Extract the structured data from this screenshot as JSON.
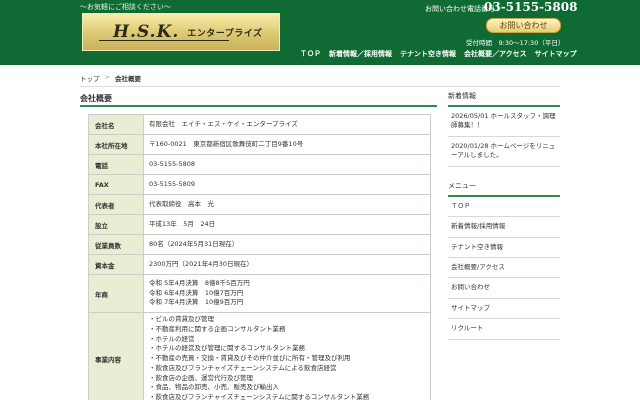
{
  "header": {
    "tagline": "～お気軽にご相談ください～",
    "logo_mark": "H.S.K.",
    "logo_sub": "エンタープライズ",
    "phone_label": "お問い合わせ電話番号",
    "phone": "03-5155-5808",
    "contact_button": "お問い合わせ",
    "hours": "受付時間　9:30～17:30（平日）",
    "nav": [
      "ＴＯＰ",
      "新着情報／採用情報",
      "テナント空き情報",
      "会社概要／アクセス",
      "サイトマップ"
    ]
  },
  "breadcrumb": {
    "home": "トップ",
    "sep": ">",
    "current": "会社概要"
  },
  "main": {
    "title": "会社概要",
    "rows": [
      {
        "label": "会社名",
        "lines": [
          "有限会社　エイチ・エス・ケイ・エンタープライズ"
        ]
      },
      {
        "label": "本社所在地",
        "lines": [
          "〒160-0021　東京都新宿区歌舞伎町二丁目9番10号"
        ]
      },
      {
        "label": "電話",
        "lines": [
          "03-5155-5808"
        ]
      },
      {
        "label": "FAX",
        "lines": [
          "03-5155-5809"
        ]
      },
      {
        "label": "代表者",
        "lines": [
          "代表取締役　高本　光"
        ]
      },
      {
        "label": "設立",
        "lines": [
          "平成13年　5月　24日"
        ]
      },
      {
        "label": "従業員数",
        "lines": [
          "80名（2024年5月31日現在）"
        ]
      },
      {
        "label": "資本金",
        "lines": [
          "2300万円（2021年4月30日現在）"
        ]
      },
      {
        "label": "年商",
        "lines": [
          "令和 5年4月決算　8億8千5百万円",
          "令和 6年4月決算　10億7百万円",
          "令和 7年4月決算　10億9百万円"
        ]
      },
      {
        "label": "事業内容",
        "lines": [
          "・ビルの賃貸及び管理",
          "・不動産利用に関する企画コンサルタント業務",
          "・ホテルの経営",
          "・ホテルの経営及び管理に関するコンサルタント業務",
          "・不動産の売買・交換・賃貸及びその仲介並びに所有・管理及び利用",
          "・飲食店及びフランチャイズチェーンシステムによる飲食店経営",
          "・飲食店の企画、運営代行及び管理",
          "・食品、物品の卸売、小売、販売及び輸出入",
          "・飲食店及びフランチャイズチェーンシステムに関するコンサルタント業務"
        ]
      }
    ]
  },
  "sidebar": {
    "news_title": "新着情報",
    "news": [
      "2026/05/01 ホールスタッフ・調理師募集！！",
      "2020/01/28 ホームページをリニューアルしました。"
    ],
    "menu_title": "メニュー",
    "menu": [
      "ＴＯＰ",
      "新着情報/採用情報",
      "テナント空き情報",
      "会社概要/アクセス",
      "お問い合わせ",
      "サイトマップ",
      "リクルート"
    ]
  },
  "colors": {
    "header_green": "#0f6b33",
    "accent_green": "#2e8a4f",
    "label_bg": "#e9edd3",
    "gold": "#dcc873"
  }
}
